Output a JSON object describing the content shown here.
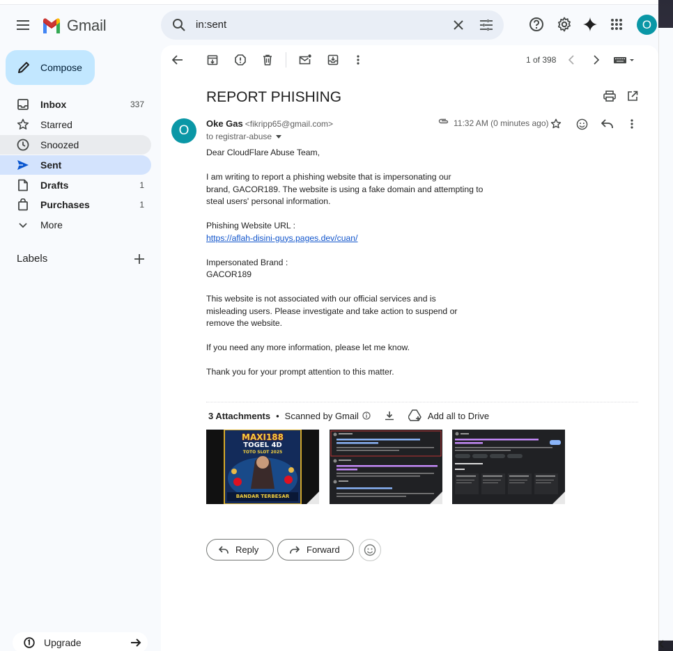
{
  "app": {
    "name": "Gmail"
  },
  "search": {
    "query": "in:sent"
  },
  "compose": {
    "label": "Compose"
  },
  "sidebar": {
    "items": [
      {
        "label": "Inbox",
        "count": "337"
      },
      {
        "label": "Starred",
        "count": ""
      },
      {
        "label": "Snoozed",
        "count": ""
      },
      {
        "label": "Sent",
        "count": ""
      },
      {
        "label": "Drafts",
        "count": "1"
      },
      {
        "label": "Purchases",
        "count": "1"
      },
      {
        "label": "More",
        "count": ""
      }
    ],
    "labels_heading": "Labels",
    "upgrade": "Upgrade"
  },
  "account": {
    "initial": "O",
    "color": "#0a97a6"
  },
  "toolbar": {
    "pager": "1 of 398"
  },
  "email": {
    "subject": "REPORT PHISHING",
    "sender_name": "Oke Gas",
    "sender_email": "<fikripp65@gmail.com>",
    "sender_initial": "O",
    "to": "to registrar-abuse",
    "time": "11:32 AM (0 minutes ago)",
    "body": {
      "greeting": "Dear CloudFlare Abuse Team,",
      "p1_l1": "I am writing to report a phishing website that is impersonating our",
      "p1_l2": "brand, GACOR189. The website is using a fake domain and attempting to",
      "p1_l3": "steal users' personal information.",
      "url_label": "Phishing Website URL :",
      "url": "https://aflah-disini-guys.pages.dev/cuan/",
      "brand_label": "Impersonated Brand :",
      "brand": "GACOR189",
      "p2_l1": "This website is not associated with our official services and is",
      "p2_l2": "misleading users. Please investigate and take action to suspend or",
      "p2_l3": "remove the website.",
      "p3": "If you need any more information, please let me know.",
      "p4": "Thank you for your prompt attention to this matter."
    },
    "attachments": {
      "count_label": "3 Attachments",
      "scanned": "Scanned by Gmail",
      "add_drive": "Add all to Drive",
      "thumb1": {
        "line1": "MAXI188",
        "line2": "TOGEL 4D",
        "line3": "TOTO SLOT 2025",
        "line4": "BANDAR TERBESAR"
      }
    }
  },
  "actions": {
    "reply": "Reply",
    "forward": "Forward"
  },
  "colors": {
    "accent": "#0a97a6",
    "selected": "#d3e3fd",
    "compose": "#c2e7ff",
    "link": "#1155cc"
  }
}
